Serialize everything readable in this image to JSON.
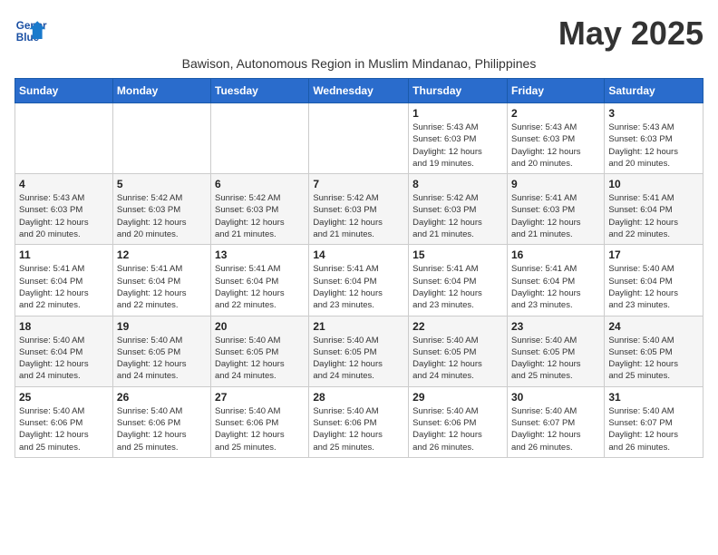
{
  "header": {
    "logo_line1": "General",
    "logo_line2": "Blue",
    "month_title": "May 2025",
    "subtitle": "Bawison, Autonomous Region in Muslim Mindanao, Philippines"
  },
  "weekdays": [
    "Sunday",
    "Monday",
    "Tuesday",
    "Wednesday",
    "Thursday",
    "Friday",
    "Saturday"
  ],
  "weeks": [
    [
      {
        "day": "",
        "detail": ""
      },
      {
        "day": "",
        "detail": ""
      },
      {
        "day": "",
        "detail": ""
      },
      {
        "day": "",
        "detail": ""
      },
      {
        "day": "1",
        "detail": "Sunrise: 5:43 AM\nSunset: 6:03 PM\nDaylight: 12 hours\nand 19 minutes."
      },
      {
        "day": "2",
        "detail": "Sunrise: 5:43 AM\nSunset: 6:03 PM\nDaylight: 12 hours\nand 20 minutes."
      },
      {
        "day": "3",
        "detail": "Sunrise: 5:43 AM\nSunset: 6:03 PM\nDaylight: 12 hours\nand 20 minutes."
      }
    ],
    [
      {
        "day": "4",
        "detail": "Sunrise: 5:43 AM\nSunset: 6:03 PM\nDaylight: 12 hours\nand 20 minutes."
      },
      {
        "day": "5",
        "detail": "Sunrise: 5:42 AM\nSunset: 6:03 PM\nDaylight: 12 hours\nand 20 minutes."
      },
      {
        "day": "6",
        "detail": "Sunrise: 5:42 AM\nSunset: 6:03 PM\nDaylight: 12 hours\nand 21 minutes."
      },
      {
        "day": "7",
        "detail": "Sunrise: 5:42 AM\nSunset: 6:03 PM\nDaylight: 12 hours\nand 21 minutes."
      },
      {
        "day": "8",
        "detail": "Sunrise: 5:42 AM\nSunset: 6:03 PM\nDaylight: 12 hours\nand 21 minutes."
      },
      {
        "day": "9",
        "detail": "Sunrise: 5:41 AM\nSunset: 6:03 PM\nDaylight: 12 hours\nand 21 minutes."
      },
      {
        "day": "10",
        "detail": "Sunrise: 5:41 AM\nSunset: 6:04 PM\nDaylight: 12 hours\nand 22 minutes."
      }
    ],
    [
      {
        "day": "11",
        "detail": "Sunrise: 5:41 AM\nSunset: 6:04 PM\nDaylight: 12 hours\nand 22 minutes."
      },
      {
        "day": "12",
        "detail": "Sunrise: 5:41 AM\nSunset: 6:04 PM\nDaylight: 12 hours\nand 22 minutes."
      },
      {
        "day": "13",
        "detail": "Sunrise: 5:41 AM\nSunset: 6:04 PM\nDaylight: 12 hours\nand 22 minutes."
      },
      {
        "day": "14",
        "detail": "Sunrise: 5:41 AM\nSunset: 6:04 PM\nDaylight: 12 hours\nand 23 minutes."
      },
      {
        "day": "15",
        "detail": "Sunrise: 5:41 AM\nSunset: 6:04 PM\nDaylight: 12 hours\nand 23 minutes."
      },
      {
        "day": "16",
        "detail": "Sunrise: 5:41 AM\nSunset: 6:04 PM\nDaylight: 12 hours\nand 23 minutes."
      },
      {
        "day": "17",
        "detail": "Sunrise: 5:40 AM\nSunset: 6:04 PM\nDaylight: 12 hours\nand 23 minutes."
      }
    ],
    [
      {
        "day": "18",
        "detail": "Sunrise: 5:40 AM\nSunset: 6:04 PM\nDaylight: 12 hours\nand 24 minutes."
      },
      {
        "day": "19",
        "detail": "Sunrise: 5:40 AM\nSunset: 6:05 PM\nDaylight: 12 hours\nand 24 minutes."
      },
      {
        "day": "20",
        "detail": "Sunrise: 5:40 AM\nSunset: 6:05 PM\nDaylight: 12 hours\nand 24 minutes."
      },
      {
        "day": "21",
        "detail": "Sunrise: 5:40 AM\nSunset: 6:05 PM\nDaylight: 12 hours\nand 24 minutes."
      },
      {
        "day": "22",
        "detail": "Sunrise: 5:40 AM\nSunset: 6:05 PM\nDaylight: 12 hours\nand 24 minutes."
      },
      {
        "day": "23",
        "detail": "Sunrise: 5:40 AM\nSunset: 6:05 PM\nDaylight: 12 hours\nand 25 minutes."
      },
      {
        "day": "24",
        "detail": "Sunrise: 5:40 AM\nSunset: 6:05 PM\nDaylight: 12 hours\nand 25 minutes."
      }
    ],
    [
      {
        "day": "25",
        "detail": "Sunrise: 5:40 AM\nSunset: 6:06 PM\nDaylight: 12 hours\nand 25 minutes."
      },
      {
        "day": "26",
        "detail": "Sunrise: 5:40 AM\nSunset: 6:06 PM\nDaylight: 12 hours\nand 25 minutes."
      },
      {
        "day": "27",
        "detail": "Sunrise: 5:40 AM\nSunset: 6:06 PM\nDaylight: 12 hours\nand 25 minutes."
      },
      {
        "day": "28",
        "detail": "Sunrise: 5:40 AM\nSunset: 6:06 PM\nDaylight: 12 hours\nand 25 minutes."
      },
      {
        "day": "29",
        "detail": "Sunrise: 5:40 AM\nSunset: 6:06 PM\nDaylight: 12 hours\nand 26 minutes."
      },
      {
        "day": "30",
        "detail": "Sunrise: 5:40 AM\nSunset: 6:07 PM\nDaylight: 12 hours\nand 26 minutes."
      },
      {
        "day": "31",
        "detail": "Sunrise: 5:40 AM\nSunset: 6:07 PM\nDaylight: 12 hours\nand 26 minutes."
      }
    ]
  ]
}
